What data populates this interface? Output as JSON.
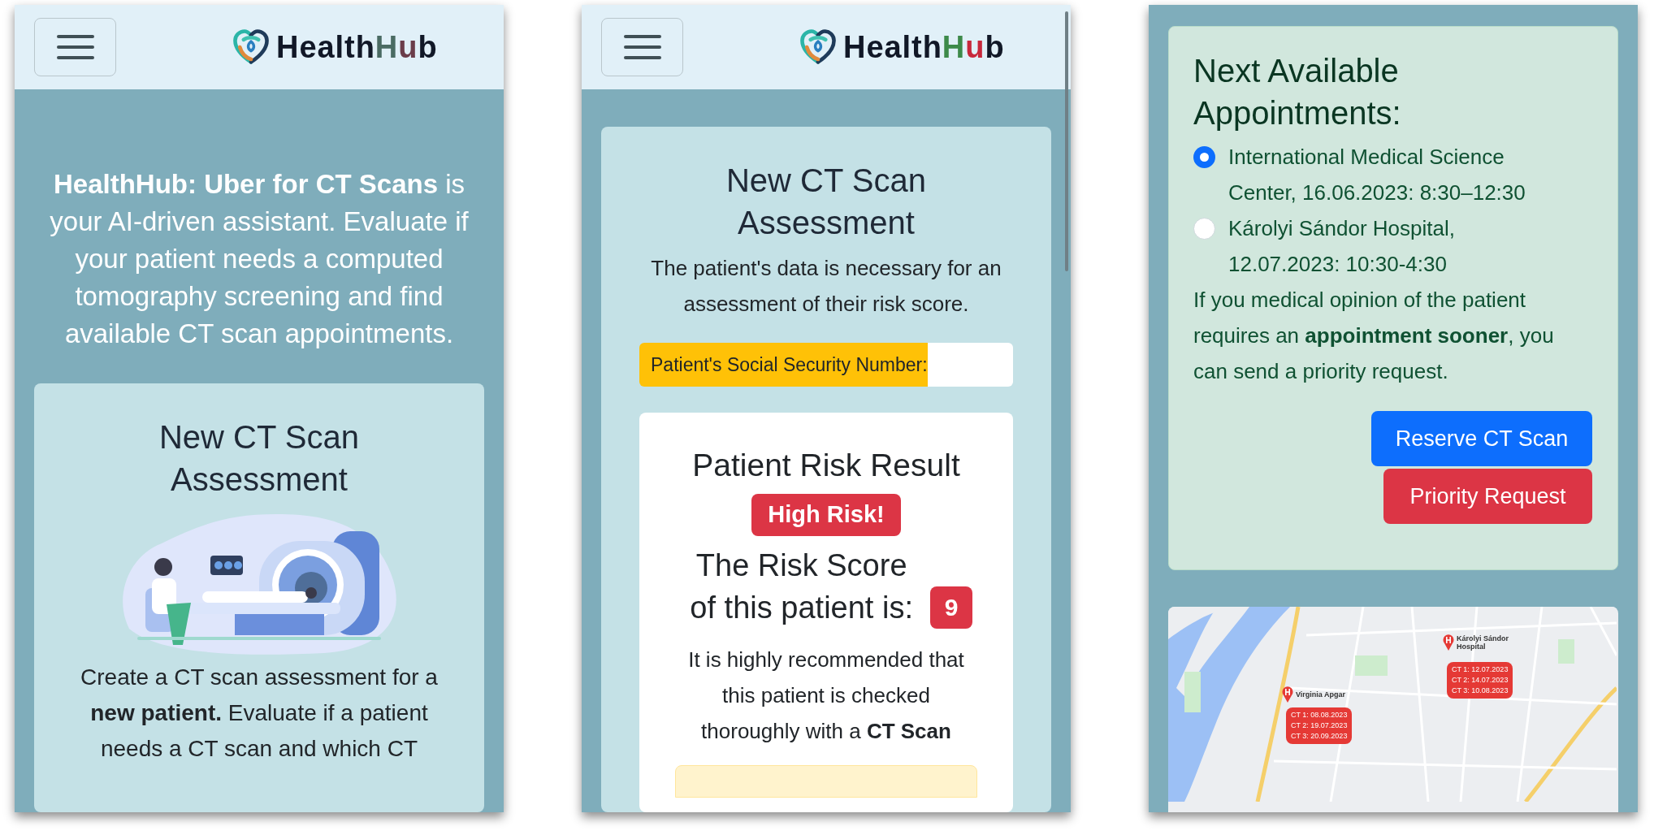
{
  "home_screen": {
    "header": {
      "logo": [
        {
          "text": "Health",
          "color": "#111827"
        },
        {
          "text": "H",
          "color": "#4a6b63"
        },
        {
          "text": "u",
          "color": "#6b3d4a"
        },
        {
          "text": "b",
          "color": "#111827"
        }
      ]
    },
    "hero": {
      "text": "**HealthHub: Uber for CT Scans** is your AI-driven assistant. Evaluate if your patient needs a computed tomography screening and find available CT scan appointments."
    },
    "card": {
      "title": "New CT Scan Assessment",
      "text": "Create a CT scan assessment for a **new patient.** Evaluate if a patient needs a CT scan and which CT"
    }
  },
  "assessment_screen": {
    "header": {
      "logo": [
        {
          "text": "Health",
          "color": "#111827"
        },
        {
          "text": "H",
          "color": "#3d8a4a"
        },
        {
          "text": "u",
          "color": "#c8283c"
        },
        {
          "text": "b",
          "color": "#111827"
        }
      ]
    },
    "title": "New CT Scan Assessment",
    "text": "The patient's data is necessary for an assessment of their risk score.",
    "ssn": {
      "label": "Patient's Social Security Number:"
    },
    "result": {
      "title": "Patient Risk Result",
      "badge": "High Risk!",
      "score_label": "The Risk Score of this patient is:",
      "score": "9",
      "text": "It is highly recommended that this patient is checked thoroughly with a **CT Scan**"
    }
  },
  "appointments_screen": {
    "title": "Next Available Appointments:",
    "options": [
      {
        "label": "International Medical Science Center, 16.06.2023: 8:30–12:30",
        "selected": true
      },
      {
        "label": "Károlyi Sándor Hospital, 12.07.2023: 10:30-4:30",
        "selected": false
      }
    ],
    "text": "If you medical opinion of the patient requires an **appointment sooner**, you can send a priority request.",
    "buttons": [
      {
        "label": "Reserve CT Scan",
        "kind": "primary"
      },
      {
        "label": "Priority Request",
        "kind": "danger"
      }
    ],
    "map": {
      "markers": [
        {
          "name": "Virginia Apgar",
          "slots": [
            "CT 1: 08.08.2023",
            "CT 2: 19.07.2023",
            "CT 3: 20.09.2023"
          ]
        },
        {
          "name": "Károlyi Sándor Hospital",
          "slots": [
            "CT 1: 12.07.2023",
            "CT 2: 14.07.2023",
            "CT 3: 10.08.2023"
          ]
        }
      ]
    }
  }
}
